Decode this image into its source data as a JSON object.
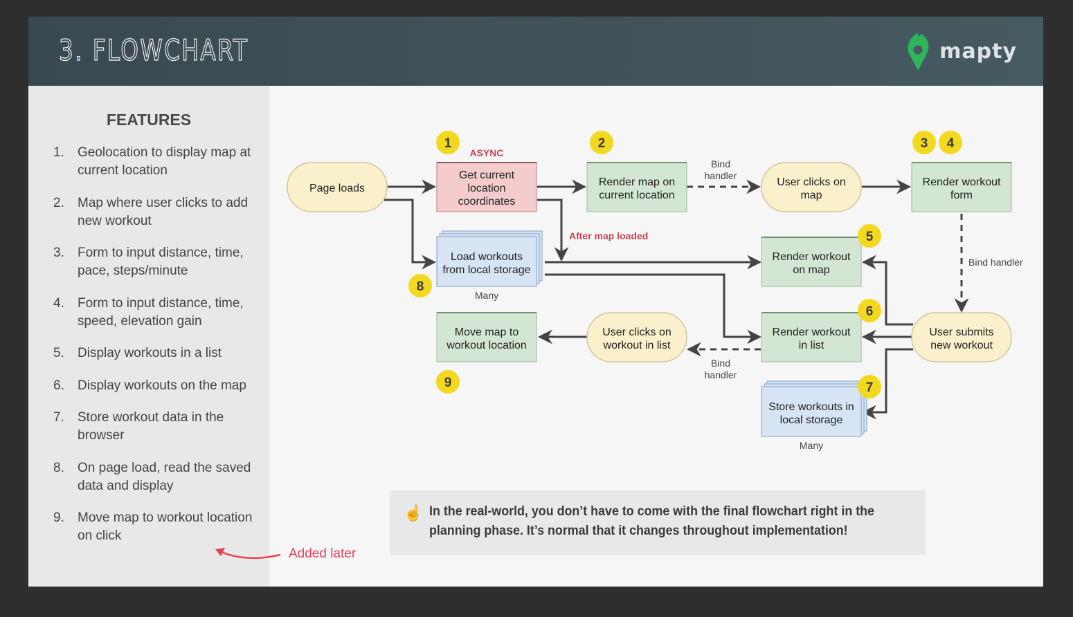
{
  "header": {
    "title": "3. FLOWCHART",
    "logo_text": "mapty",
    "logo_icon": "map-pin-icon"
  },
  "sidebar": {
    "title": "FEATURES",
    "features": [
      {
        "num": "1.",
        "text": "Geolocation to display map at current location"
      },
      {
        "num": "2.",
        "text": "Map where user clicks to add new workout"
      },
      {
        "num": "3.",
        "text": "Form to input distance, time, pace, steps/minute"
      },
      {
        "num": "4.",
        "text": "Form to input distance, time, speed, elevation gain"
      },
      {
        "num": "5.",
        "text": "Display workouts in a list"
      },
      {
        "num": "6.",
        "text": "Display workouts on the map"
      },
      {
        "num": "7.",
        "text": "Store workout data in the browser"
      },
      {
        "num": "8.",
        "text": "On page load, read the saved data and display"
      },
      {
        "num": "9.",
        "text": "Move map to workout location on click"
      }
    ]
  },
  "annotation": {
    "added_later": "Added later"
  },
  "tip": {
    "icon": "pointing-up-icon",
    "text": "In the real-world, you don’t have to come with the final flowchart right in the planning phase. It’s normal that it changes throughout implementation!"
  },
  "colors": {
    "event": "#fbf0cc",
    "action": "#d3e6d3",
    "async": "#f4cccc",
    "storage": "#d6e4f4",
    "badge": "#f2d81e",
    "accent_red": "#e8405a",
    "header": "#3a4950",
    "logo_green": "#2fb45a"
  },
  "flowchart": {
    "nodes": {
      "page_loads": {
        "type": "event",
        "lines": [
          "Page loads"
        ]
      },
      "get_location": {
        "type": "async",
        "lines": [
          "Get current",
          "location",
          "coordinates"
        ],
        "tag": "ASYNC",
        "badges": [
          "1"
        ]
      },
      "render_map": {
        "type": "action",
        "lines": [
          "Render map on",
          "current location"
        ],
        "badges": [
          "2"
        ]
      },
      "user_clicks_map": {
        "type": "event",
        "lines": [
          "User clicks on",
          "map"
        ]
      },
      "render_form": {
        "type": "action",
        "lines": [
          "Render workout",
          "form"
        ],
        "badges": [
          "3",
          "4"
        ]
      },
      "load_workouts": {
        "type": "storage",
        "lines": [
          "Load workouts",
          "from local storage"
        ],
        "caption": "Many",
        "badges": [
          "8"
        ]
      },
      "render_on_map": {
        "type": "action",
        "lines": [
          "Render workout",
          "on map"
        ],
        "badges": [
          "5"
        ]
      },
      "render_in_list": {
        "type": "action",
        "lines": [
          "Render workout",
          "in list"
        ],
        "badges": [
          "6"
        ]
      },
      "user_submits": {
        "type": "event",
        "lines": [
          "User submits",
          "new workout"
        ]
      },
      "store_workouts": {
        "type": "storage",
        "lines": [
          "Store workouts in",
          "local storage"
        ],
        "caption": "Many",
        "badges": [
          "7"
        ]
      },
      "move_map": {
        "type": "action",
        "lines": [
          "Move map to",
          "workout location"
        ],
        "badges": [
          "9"
        ]
      },
      "user_clicks_list": {
        "type": "event",
        "lines": [
          "User clicks on",
          "workout in list"
        ]
      }
    },
    "edge_labels": {
      "bind_handler_1": [
        "Bind",
        "handler"
      ],
      "bind_handler_2": [
        "Bind handler"
      ],
      "bind_handler_3": [
        "Bind",
        "handler"
      ],
      "after_map_loaded": [
        "After map loaded"
      ]
    },
    "edges": [
      {
        "from": "page_loads",
        "to": "get_location",
        "style": "solid"
      },
      {
        "from": "page_loads",
        "to": "load_workouts",
        "style": "solid"
      },
      {
        "from": "get_location",
        "to": "render_map",
        "style": "solid"
      },
      {
        "from": "get_location",
        "to": "load_workouts_output",
        "style": "solid",
        "label": "after_map_loaded"
      },
      {
        "from": "render_map",
        "to": "user_clicks_map",
        "style": "dashed",
        "label": "bind_handler_1"
      },
      {
        "from": "user_clicks_map",
        "to": "render_form",
        "style": "solid"
      },
      {
        "from": "render_form",
        "to": "user_submits",
        "style": "dashed",
        "label": "bind_handler_2"
      },
      {
        "from": "load_workouts",
        "to": "render_on_map",
        "style": "solid"
      },
      {
        "from": "load_workouts",
        "to": "render_in_list",
        "style": "solid"
      },
      {
        "from": "user_submits",
        "to": "render_on_map",
        "style": "solid"
      },
      {
        "from": "user_submits",
        "to": "render_in_list",
        "style": "solid"
      },
      {
        "from": "user_submits",
        "to": "store_workouts",
        "style": "solid"
      },
      {
        "from": "render_in_list",
        "to": "user_clicks_list",
        "style": "dashed",
        "label": "bind_handler_3"
      },
      {
        "from": "user_clicks_list",
        "to": "move_map",
        "style": "solid"
      }
    ]
  }
}
